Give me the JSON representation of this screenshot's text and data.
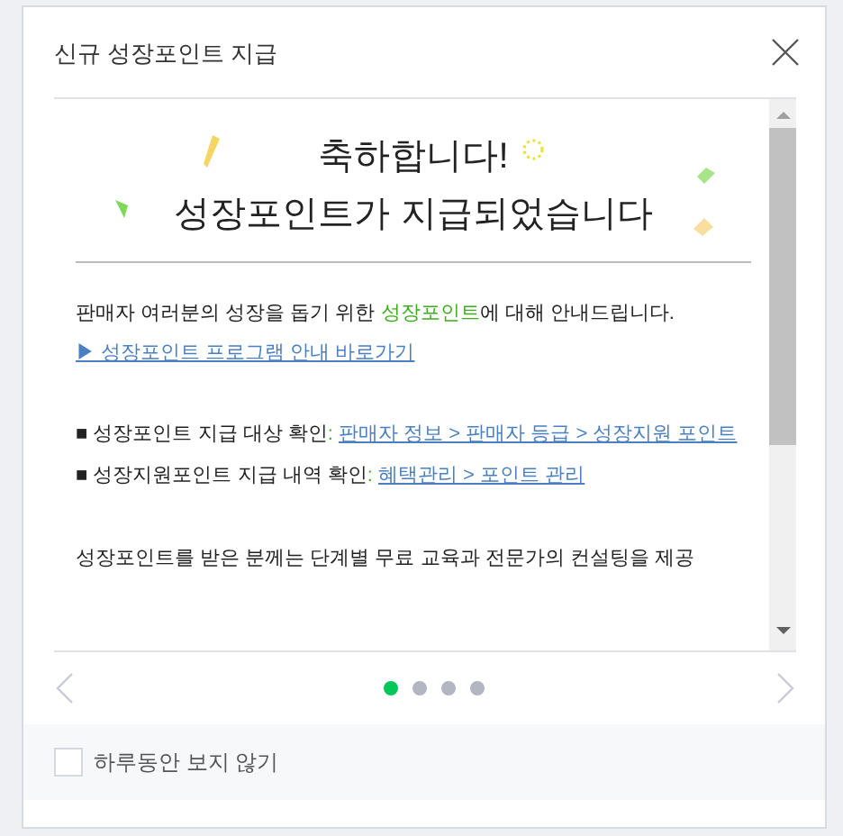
{
  "dialog": {
    "title": "신규 성장포인트 지급",
    "heading": [
      "축하합니다!",
      "성장포인트가 지급되었습니다"
    ],
    "intro": "판매자 여러분의 성장을 돕기 위한 **성장포인트**에 대해 안내드립니다.",
    "program_link": "▶ 성장포인트 프로그램 안내 바로가기",
    "checks": [
      {
        "label": "■ 성장포인트 지급 대상 확인",
        "separator": ":",
        "link": "판매자 정보 > 판매자 등급 > 성장지원 포인트"
      },
      {
        "label": "■ 성장지원포인트 지급 내역 확인",
        "separator": ":",
        "link": "혜택관리 > 포인트 관리"
      }
    ],
    "closing": "성장포인트를 받은 분께는 단계별 무료 교육과 전문가의 컨설팅을 제공",
    "pages": [
      {
        "selected": true
      },
      {
        "selected": false
      },
      {
        "selected": false
      },
      {
        "selected": false
      }
    ],
    "hide_today": {
      "label": "하루동안 보지 않기",
      "checked": false
    }
  }
}
